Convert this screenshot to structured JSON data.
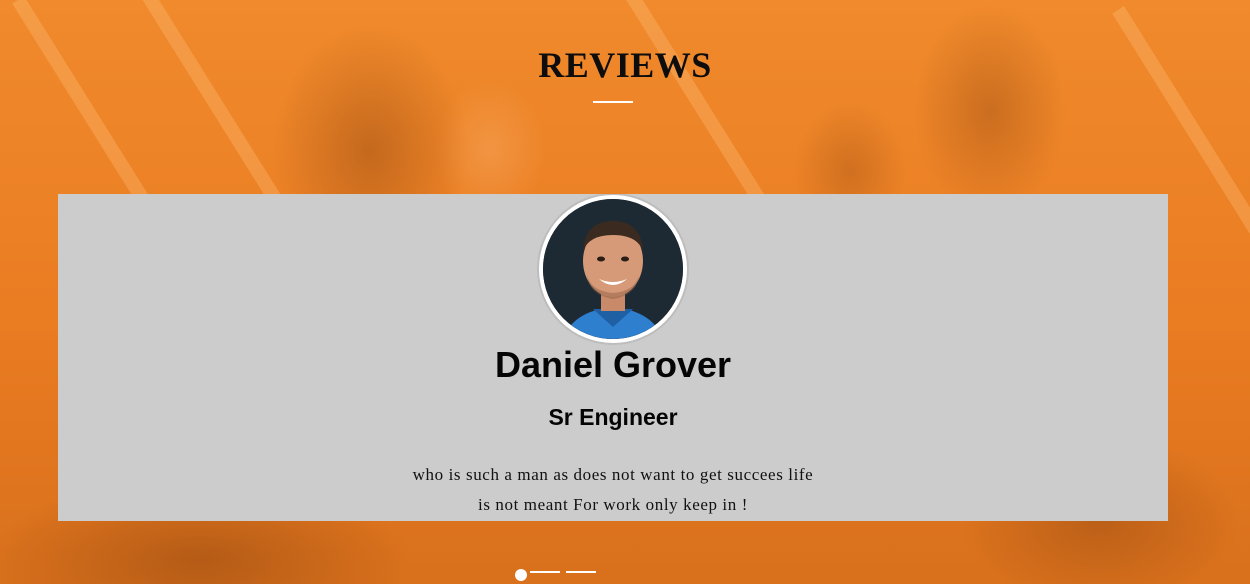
{
  "section": {
    "title": "REVIEWS"
  },
  "review": {
    "name": "Daniel Grover",
    "role": "Sr Engineer",
    "text_line1": "who is such a man as does not want to get succees life",
    "text_line2": "is not meant For work only keep in !"
  },
  "carousel": {
    "slide_count": 3,
    "active_index": 0
  },
  "colors": {
    "background_accent": "#ea7d22",
    "card_background": "#cccccc",
    "title_text": "#0d0d0d",
    "indicator": "#ffffff"
  }
}
